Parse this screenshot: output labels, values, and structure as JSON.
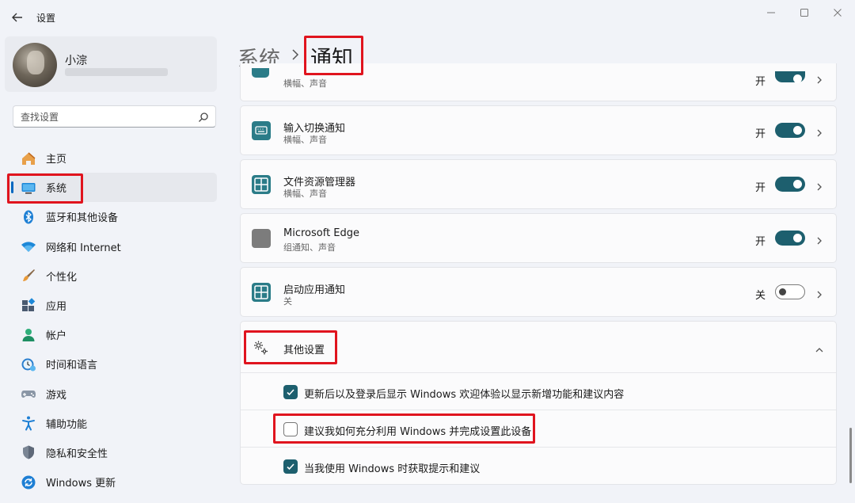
{
  "window": {
    "title": "设置",
    "accent": "#0067c0",
    "toggle_on_color": "#1d5f6e",
    "highlight_color": "#e0141e"
  },
  "profile": {
    "name": "小淙"
  },
  "search": {
    "placeholder": "查找设置"
  },
  "sidebar": {
    "items": [
      {
        "label": "主页",
        "icon": "home-icon"
      },
      {
        "label": "系统",
        "icon": "monitor-icon",
        "active": true
      },
      {
        "label": "蓝牙和其他设备",
        "icon": "bluetooth-icon"
      },
      {
        "label": "网络和 Internet",
        "icon": "wifi-icon"
      },
      {
        "label": "个性化",
        "icon": "brush-icon"
      },
      {
        "label": "应用",
        "icon": "apps-icon"
      },
      {
        "label": "帐户",
        "icon": "account-icon"
      },
      {
        "label": "时间和语言",
        "icon": "clock-globe-icon"
      },
      {
        "label": "游戏",
        "icon": "gamepad-icon"
      },
      {
        "label": "辅助功能",
        "icon": "accessibility-icon"
      },
      {
        "label": "隐私和安全性",
        "icon": "shield-icon"
      },
      {
        "label": "Windows 更新",
        "icon": "update-icon"
      }
    ]
  },
  "header": {
    "parent": "系统",
    "current": "通知"
  },
  "apps": [
    {
      "title": "",
      "subtitle": "横幅、声音",
      "state": "开",
      "on": true
    },
    {
      "title": "输入切换通知",
      "subtitle": "横幅、声音",
      "state": "开",
      "on": true
    },
    {
      "title": "文件资源管理器",
      "subtitle": "横幅、声音",
      "state": "开",
      "on": true
    },
    {
      "title": "Microsoft Edge",
      "subtitle": "组通知、声音",
      "state": "开",
      "on": true
    },
    {
      "title": "启动应用通知",
      "subtitle": "关",
      "state": "关",
      "on": false
    }
  ],
  "other_settings": {
    "title": "其他设置",
    "options": [
      {
        "label": "更新后以及登录后显示 Windows 欢迎体验以显示新增功能和建议内容",
        "checked": true
      },
      {
        "label": "建议我如何充分利用 Windows 并完成设置此设备",
        "checked": false
      },
      {
        "label": "当我使用 Windows 时获取提示和建议",
        "checked": true
      }
    ]
  }
}
